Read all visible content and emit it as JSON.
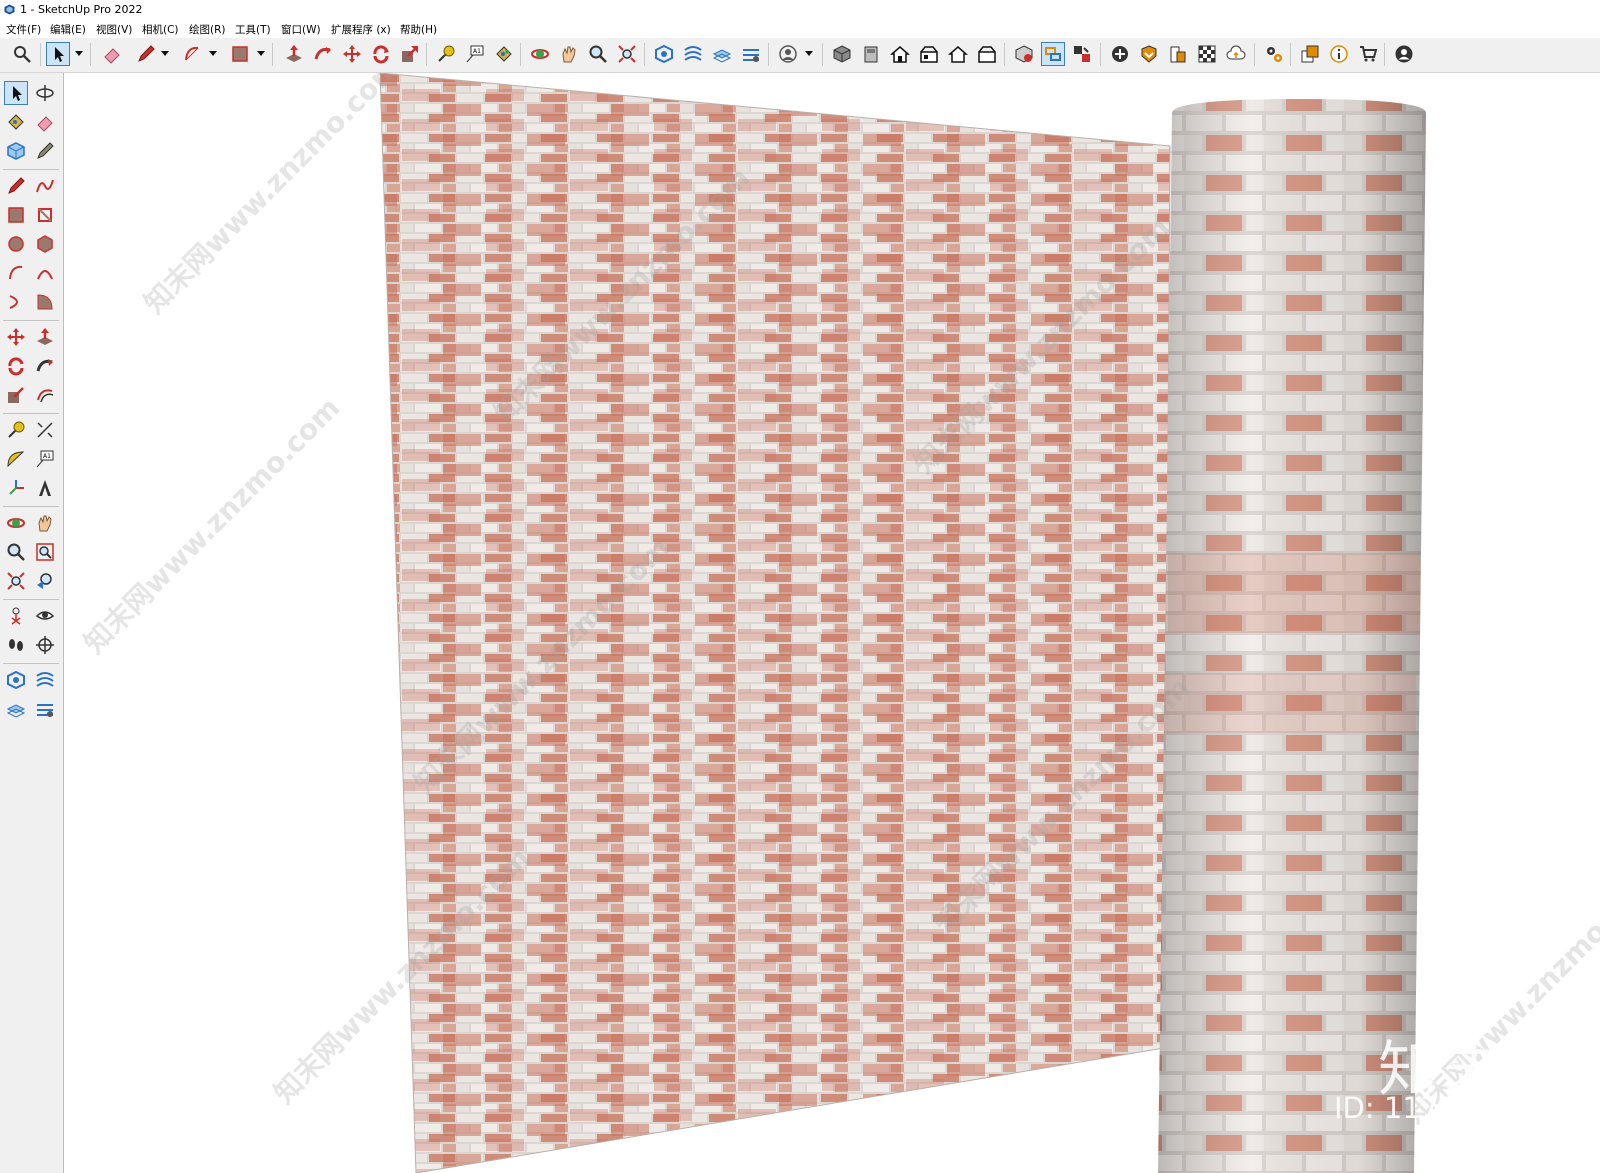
{
  "window": {
    "title": "1 - SketchUp Pro 2022"
  },
  "menu": [
    {
      "label": "文件(F)"
    },
    {
      "label": "编辑(E)"
    },
    {
      "label": "视图(V)"
    },
    {
      "label": "相机(C)"
    },
    {
      "label": "绘图(R)"
    },
    {
      "label": "工具(T)"
    },
    {
      "label": "窗口(W)"
    },
    {
      "label": "扩展程序 (x)"
    },
    {
      "label": "帮助(H)"
    }
  ],
  "toolbar_icons": [
    "search-icon",
    "select-icon",
    "eraser-icon",
    "pencil-icon",
    "arc-icon",
    "rectangle-icon",
    "push-pull-icon",
    "follow-me-icon",
    "move-icon",
    "rotate-icon",
    "scale-icon",
    "tape-measure-icon",
    "text-icon",
    "paint-bucket-icon",
    "orbit-icon",
    "pan-icon",
    "zoom-icon",
    "zoom-extents-icon",
    "sandbox-icon",
    "sandbox-smoove-icon",
    "sandbox-stamp-icon",
    "sandbox-flip-icon",
    "user-icon",
    "iso-view-icon",
    "top-view-icon",
    "front-view-icon",
    "right-view-icon",
    "back-view-icon",
    "left-view-icon",
    "component-icon",
    "group-icon",
    "tag-icon",
    "add-location-icon",
    "warehouse-icon",
    "extension-icon",
    "styles-icon",
    "cloud-icon",
    "settings-icon",
    "layout-icon",
    "info-icon",
    "cart-icon",
    "account-icon"
  ],
  "left_tools": [
    "select-icon",
    "orbit-icon",
    "paint-bucket-icon",
    "eraser-icon",
    "component-icon",
    "tag-icon",
    "pencil-icon",
    "freehand-icon",
    "rectangle-icon",
    "rotated-rectangle-icon",
    "circle-icon",
    "polygon-icon",
    "arc-icon",
    "two-point-arc-icon",
    "three-point-arc-icon",
    "pie-icon",
    "move-icon",
    "push-pull-icon",
    "rotate-icon",
    "follow-me-icon",
    "scale-icon",
    "offset-icon",
    "tape-measure-icon",
    "dimension-icon",
    "protractor-icon",
    "text-label-icon",
    "axes-icon",
    "3d-text-icon",
    "orbit-tool-icon",
    "pan-tool-icon",
    "zoom-tool-icon",
    "zoom-window-icon",
    "zoom-extents-tool-icon",
    "previous-view-icon",
    "position-camera-icon",
    "look-around-icon",
    "walk-icon",
    "section-plane-icon",
    "sandbox-from-contours-icon",
    "sandbox-from-scratch-icon",
    "sandbox-smoove-tool-icon",
    "sandbox-stamp-tool-icon"
  ],
  "viewport": {
    "watermark_text": "知末网www.znzmo.com",
    "brand": "知末",
    "brand_id": "ID: 1177457539"
  },
  "colors": {
    "accent": "#3c7fb1",
    "brick_red": "#c77a66",
    "mortar": "#dcd6d2"
  }
}
